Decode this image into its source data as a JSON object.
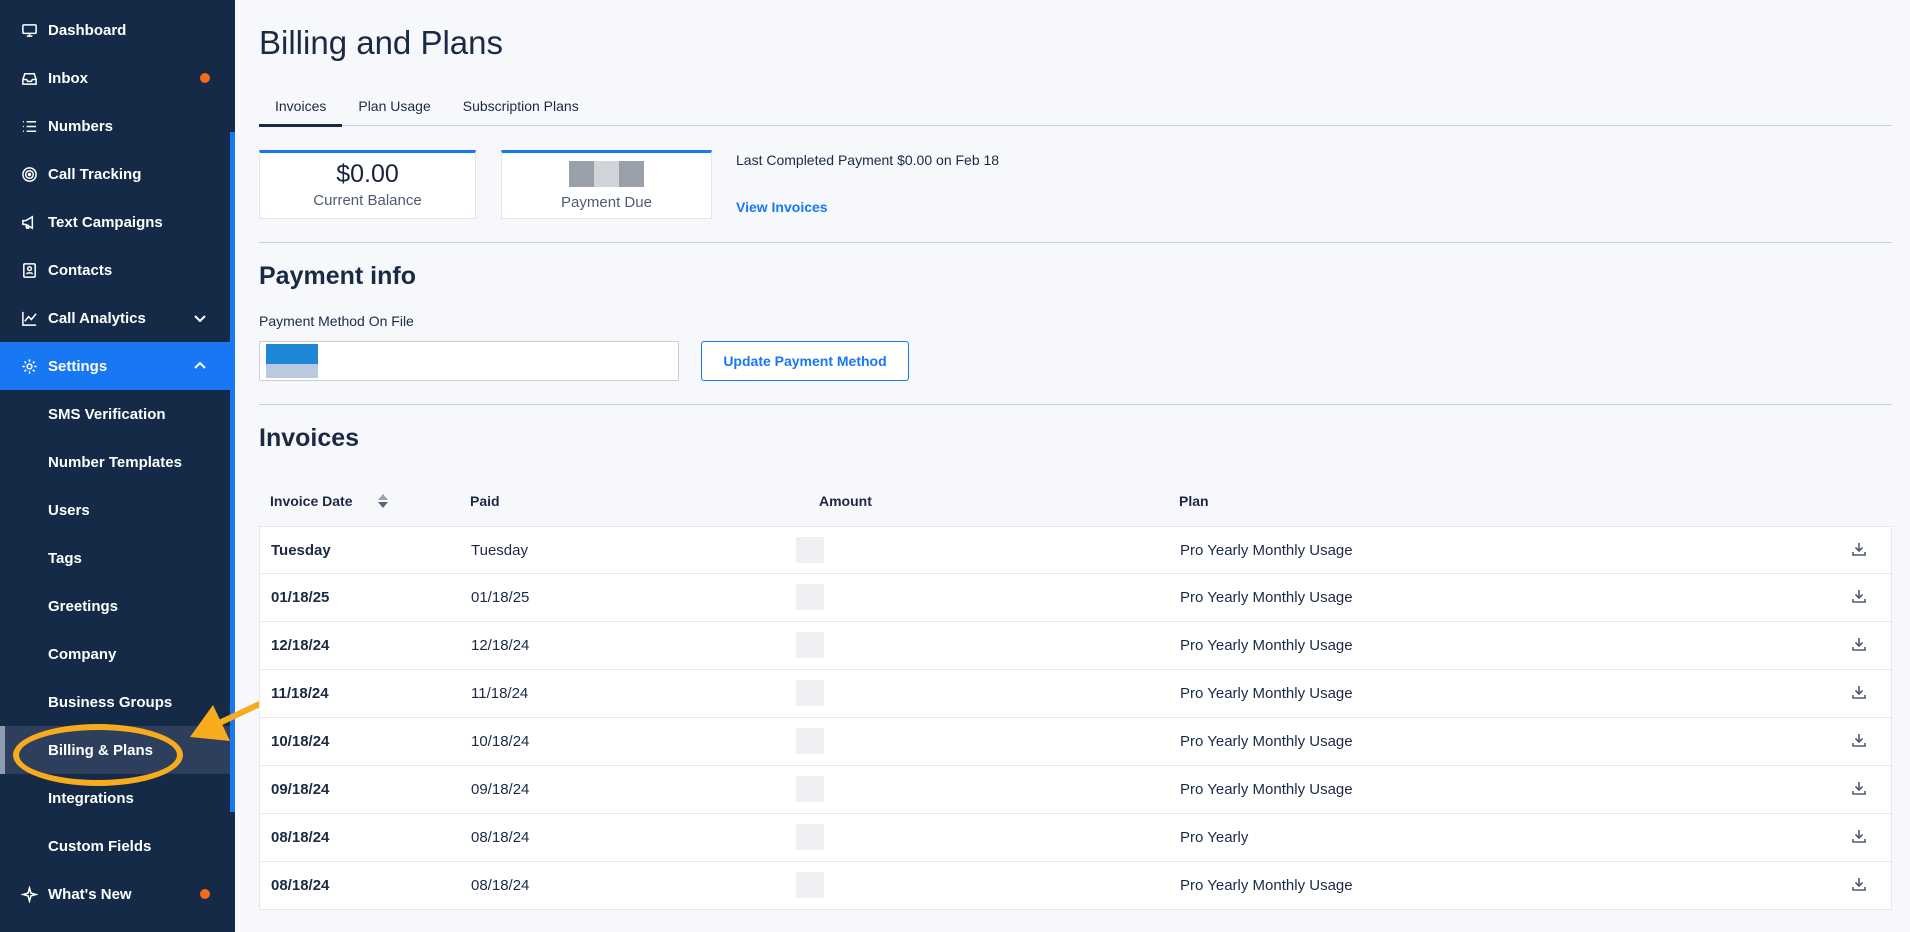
{
  "sidebar": {
    "items": [
      {
        "label": "Dashboard",
        "icon": "monitor-icon"
      },
      {
        "label": "Inbox",
        "icon": "inbox-icon",
        "dot": true
      },
      {
        "label": "Numbers",
        "icon": "list-icon"
      },
      {
        "label": "Call Tracking",
        "icon": "target-icon"
      },
      {
        "label": "Text Campaigns",
        "icon": "megaphone-icon"
      },
      {
        "label": "Contacts",
        "icon": "contact-card-icon"
      },
      {
        "label": "Call Analytics",
        "icon": "line-chart-icon",
        "chevron": "down"
      },
      {
        "label": "Settings",
        "icon": "gear-icon",
        "chevron": "up",
        "active": true
      }
    ],
    "settings_sub": [
      "SMS Verification",
      "Number Templates",
      "Users",
      "Tags",
      "Greetings",
      "Company",
      "Business Groups",
      "Billing & Plans",
      "Integrations",
      "Custom Fields"
    ],
    "whats_new": "What's New"
  },
  "page": {
    "title": "Billing and Plans",
    "tabs": [
      "Invoices",
      "Plan Usage",
      "Subscription Plans"
    ],
    "active_tab": "Invoices"
  },
  "summary": {
    "balance_value": "$0.00",
    "balance_label": "Current Balance",
    "payment_due_label": "Payment Due",
    "last_payment_prefix": "Last Completed Payment ",
    "last_payment_amount": "$0.00",
    "last_payment_suffix": " on Feb 18",
    "view_invoices": "View Invoices"
  },
  "payment_info": {
    "title": "Payment info",
    "method_label": "Payment Method On File",
    "update_button": "Update Payment Method"
  },
  "invoices": {
    "title": "Invoices",
    "columns": [
      "Invoice Date",
      "Paid",
      "Amount",
      "Plan"
    ],
    "rows": [
      {
        "date": "Tuesday",
        "paid": "Tuesday",
        "plan": "Pro Yearly Monthly Usage"
      },
      {
        "date": "01/18/25",
        "paid": "01/18/25",
        "plan": "Pro Yearly Monthly Usage"
      },
      {
        "date": "12/18/24",
        "paid": "12/18/24",
        "plan": "Pro Yearly Monthly Usage"
      },
      {
        "date": "11/18/24",
        "paid": "11/18/24",
        "plan": "Pro Yearly Monthly Usage"
      },
      {
        "date": "10/18/24",
        "paid": "10/18/24",
        "plan": "Pro Yearly Monthly Usage"
      },
      {
        "date": "09/18/24",
        "paid": "09/18/24",
        "plan": "Pro Yearly Monthly Usage"
      },
      {
        "date": "08/18/24",
        "paid": "08/18/24",
        "plan": "Pro Yearly"
      },
      {
        "date": "08/18/24",
        "paid": "08/18/24",
        "plan": "Pro Yearly Monthly Usage"
      }
    ]
  },
  "colors": {
    "sidebar_bg": "#152a47",
    "accent": "#1877f2",
    "notification_dot": "#f26a1b",
    "annotation": "#f7ac1d"
  }
}
